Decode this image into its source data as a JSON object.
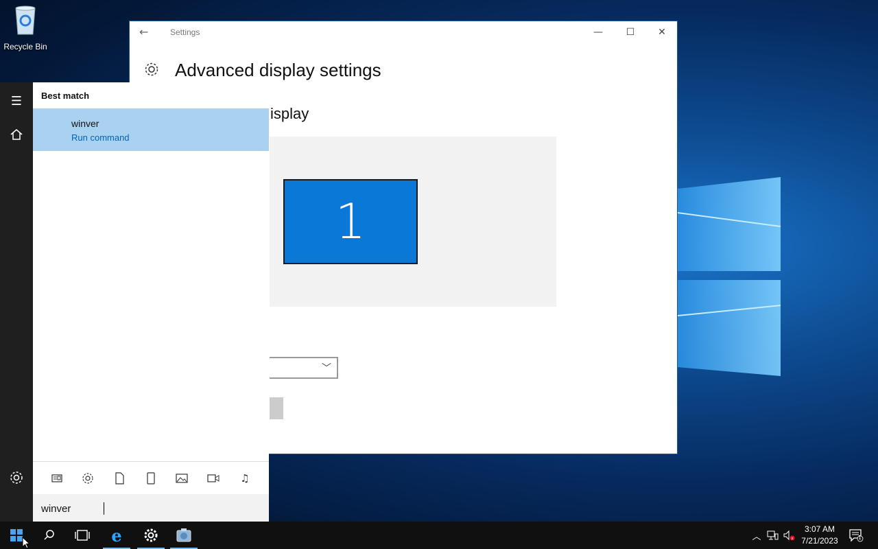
{
  "desktop": {
    "recycle_bin_label": "Recycle Bin"
  },
  "settings_window": {
    "title": "Settings",
    "heading": "Advanced display settings",
    "subheading_fragment": "isplay",
    "monitor_number": "1",
    "controls": {
      "minimize": "—",
      "maximize": "☐",
      "close": "✕"
    }
  },
  "start_menu": {
    "section_label": "Best match",
    "result": {
      "name": "winver",
      "type": "Run command"
    },
    "filter_icons": [
      "news-icon",
      "settings-icon",
      "document-icon",
      "tablet-icon",
      "photo-icon",
      "video-icon",
      "music-icon"
    ],
    "search_value": "winver"
  },
  "taskbar": {
    "time": "3:07 AM",
    "date": "7/21/2023",
    "notification_count": "1"
  },
  "colors": {
    "accent": "#0a78d7",
    "selection": "#a9d2f1",
    "link": "#0063b1"
  }
}
